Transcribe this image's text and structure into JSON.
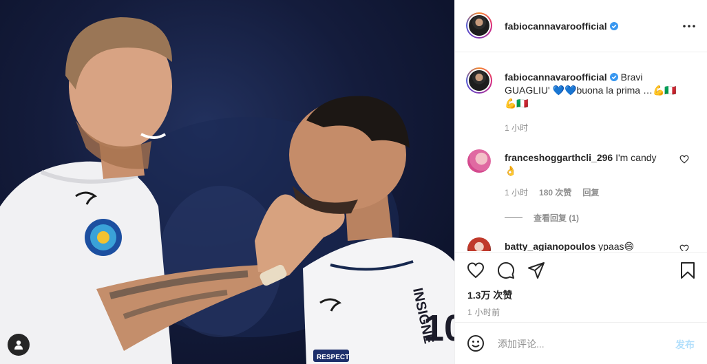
{
  "post": {
    "author": "fabiocannavaroofficial",
    "caption_text": "Bravi GUAGLIU' 💙💙buona la prima …💪🇮🇹💪🇮🇹",
    "caption_time": "1 小时",
    "photo_jersey_text": "INSIGNE",
    "photo_badge_text": "RESPECT"
  },
  "header": {
    "username": "fabiocannavaroofficial",
    "more_icon": "more-horizontal-icon"
  },
  "comments": [
    {
      "username": "franceshoggarthcli_296",
      "text": "I'm candy 👌",
      "time": "1 小时",
      "likes": "180 次赞",
      "reply_label": "回复",
      "view_replies": "查看回复 (1)"
    },
    {
      "username": "batty_agianopoulos",
      "text": "ypaas😄"
    }
  ],
  "actions": {
    "likes_count": "1.3万 次赞",
    "post_time": "1 小时前",
    "icons": [
      "heart-icon",
      "comment-icon",
      "share-icon",
      "bookmark-icon"
    ]
  },
  "composer": {
    "placeholder": "添加评论...",
    "submit_label": "发布"
  },
  "colors": {
    "verified": "#3897f0",
    "post_disabled": "#b2dffc",
    "muted": "#8e8e8e"
  }
}
